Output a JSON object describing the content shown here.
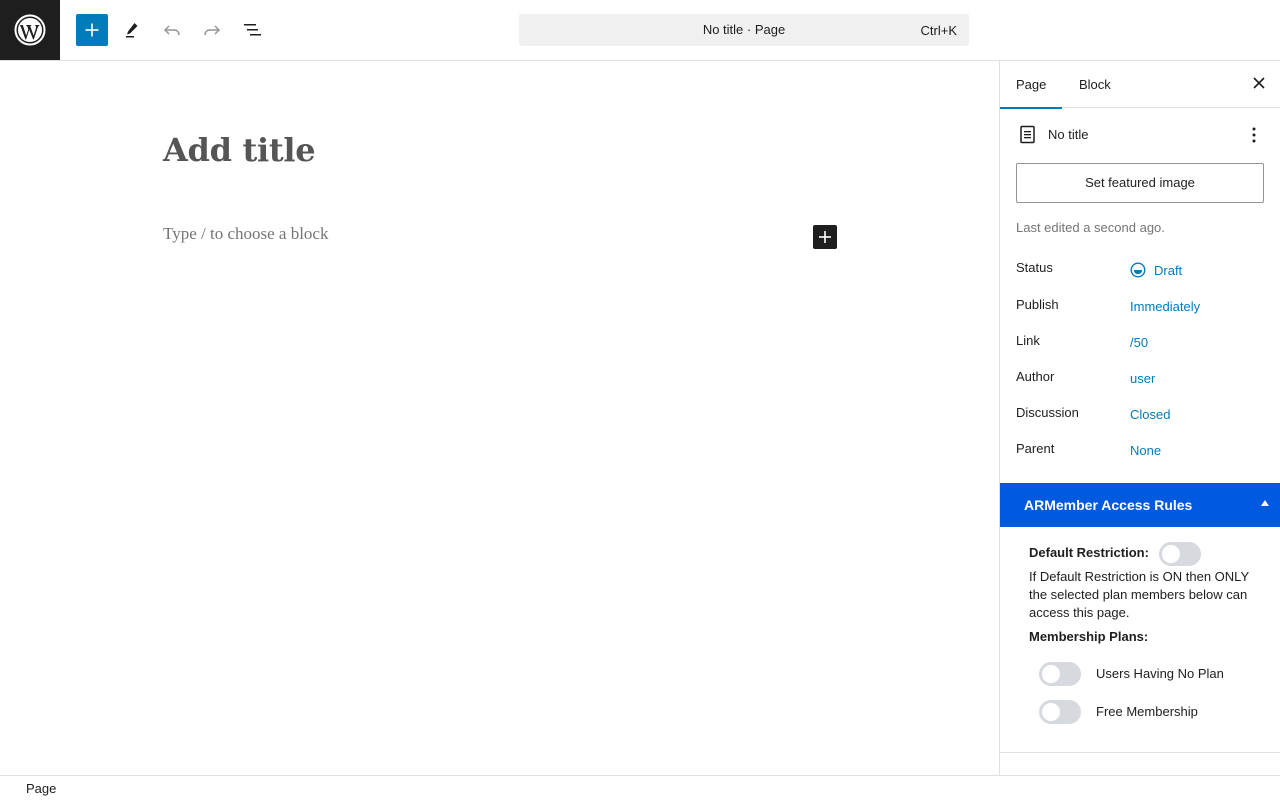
{
  "toolbar": {
    "doc_title": "No title · Page",
    "shortcut": "Ctrl+K",
    "icons": [
      "wordpress-logo",
      "plus-icon",
      "pencil-icon",
      "undo-icon",
      "redo-icon",
      "list-view-icon"
    ]
  },
  "editor": {
    "title_placeholder": "Add title",
    "block_placeholder": "Type / to choose a block"
  },
  "sidebar": {
    "tabs": [
      {
        "label": "Page",
        "active": true
      },
      {
        "label": "Block",
        "active": false
      }
    ],
    "document": {
      "title": "No title",
      "featured_button": "Set featured image",
      "last_edited": "Last edited a second ago."
    },
    "meta": [
      {
        "label": "Status",
        "value": "Draft"
      },
      {
        "label": "Publish",
        "value": "Immediately"
      },
      {
        "label": "Link",
        "value": "/50"
      },
      {
        "label": "Author",
        "value": "user"
      },
      {
        "label": "Discussion",
        "value": "Closed"
      },
      {
        "label": "Parent",
        "value": "None"
      }
    ],
    "armember": {
      "title": "ARMember Access Rules",
      "default_label": "Default Restriction:",
      "default_on": false,
      "description": "If Default Restriction is ON then ONLY the selected plan members below can access this page.",
      "plans_label": "Membership Plans:",
      "plans": [
        {
          "label": "Users Having No Plan",
          "on": false
        },
        {
          "label": "Free Membership",
          "on": false
        }
      ]
    }
  },
  "footer": {
    "breadcrumb": "Page"
  },
  "colors": {
    "accent": "#007cba",
    "armember_header": "#005ae0",
    "toggle_off": "#d6d9de"
  }
}
